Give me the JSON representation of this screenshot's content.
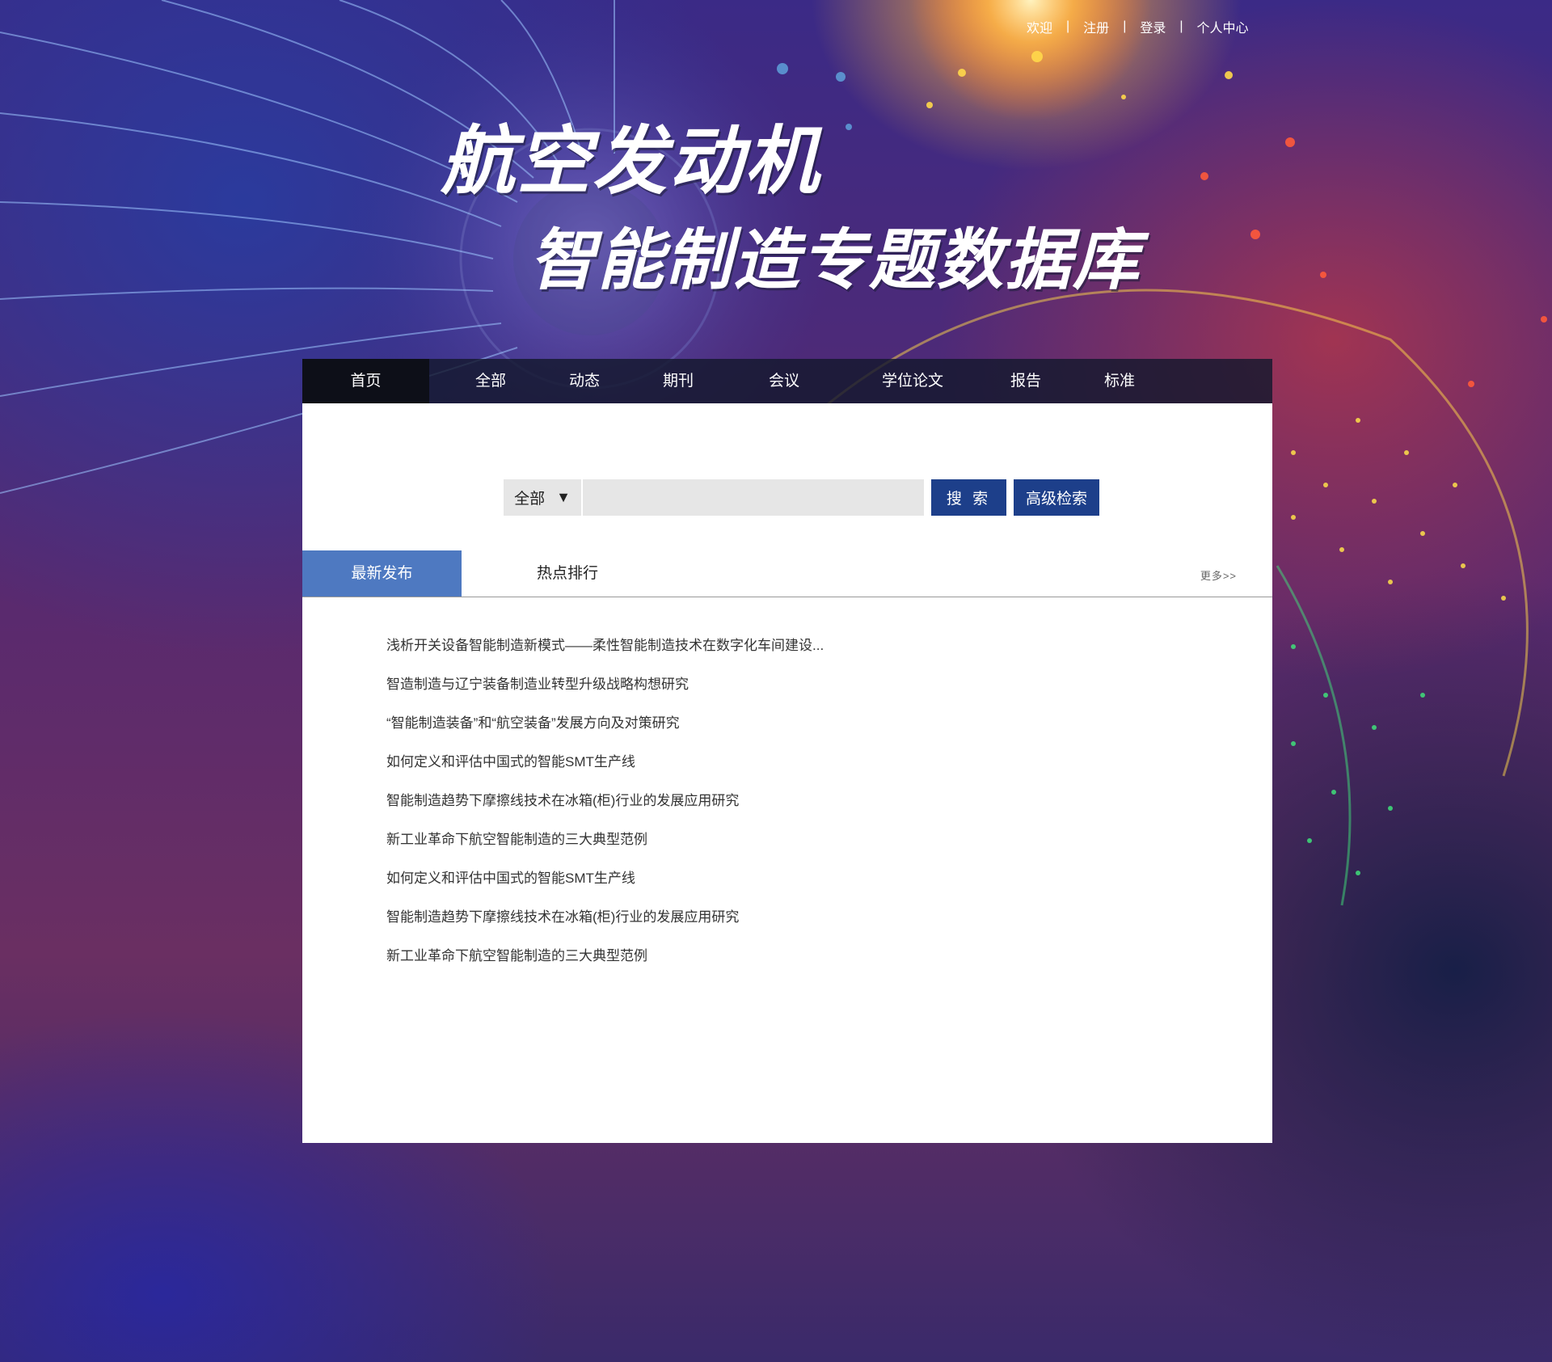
{
  "topbar": {
    "welcome": "欢迎",
    "register": "注册",
    "login": "登录",
    "user_center": "个人中心",
    "separator": "|"
  },
  "hero": {
    "line1": "航空发动机",
    "line2": "智能制造专题数据库"
  },
  "nav": {
    "items": [
      "首页",
      "全部",
      "动态",
      "期刊",
      "会议",
      "学位论文",
      "报告",
      "标准"
    ],
    "active": "首页"
  },
  "search": {
    "scope": "全部",
    "query": "",
    "search_button": "搜 索",
    "advanced_button": "高级检索"
  },
  "tabs": {
    "latest": "最新发布",
    "hot": "热点排行",
    "more": "更多>>"
  },
  "articles": [
    "浅析开关设备智能制造新模式——柔性智能制造技术在数字化车间建设...",
    "智造制造与辽宁装备制造业转型升级战略构想研究",
    "“智能制造装备”和“航空装备”发展方向及对策研究",
    "如何定义和评估中国式的智能SMT生产线",
    "智能制造趋势下摩擦线技术在冰箱(柜)行业的发展应用研究",
    "新工业革命下航空智能制造的三大典型范例",
    "如何定义和评估中国式的智能SMT生产线",
    "智能制造趋势下摩擦线技术在冰箱(柜)行业的发展应用研究",
    "新工业革命下航空智能制造的三大典型范例"
  ],
  "colors": {
    "nav_bg": "#14192d",
    "nav_active": "#0d0f18",
    "button": "#1d3f8a",
    "tab_active": "#4e79c1"
  }
}
